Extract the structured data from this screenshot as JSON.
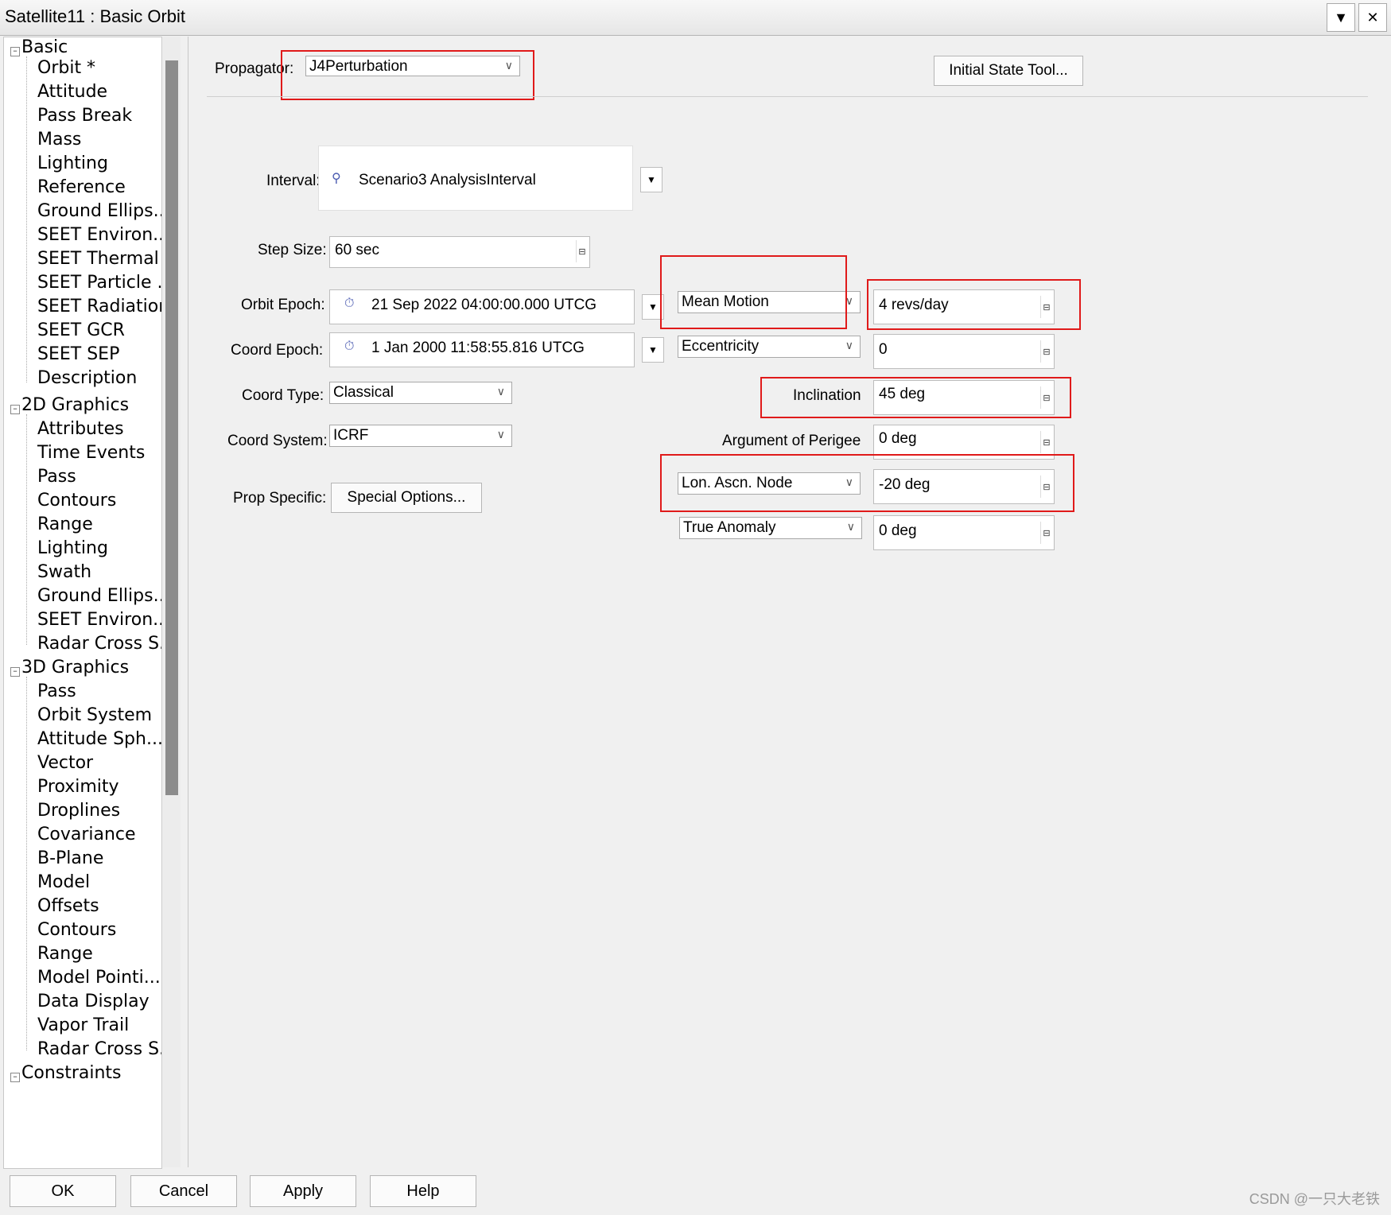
{
  "window": {
    "title": "Satellite11 : Basic Orbit",
    "menu_icon": "chevron-down-icon",
    "close_label": "✕"
  },
  "tree": {
    "groups": [
      {
        "label": "Basic",
        "items": [
          "Orbit *",
          "Attitude",
          "Pass Break",
          "Mass",
          "Lighting",
          "Reference",
          "Ground Ellips...",
          "SEET Environ...",
          "SEET Thermal",
          "SEET Particle ...",
          "SEET Radiation",
          "SEET GCR",
          "SEET SEP",
          "Description"
        ]
      },
      {
        "label": "2D Graphics",
        "items": [
          "Attributes",
          "Time Events",
          "Pass",
          "Contours",
          "Range",
          "Lighting",
          "Swath",
          "Ground Ellips...",
          "SEET Environ...",
          "Radar Cross S..."
        ]
      },
      {
        "label": "3D Graphics",
        "items": [
          "Pass",
          "Orbit System",
          "Attitude Sph...",
          "Vector",
          "Proximity",
          "Droplines",
          "Covariance",
          "B-Plane",
          "Model",
          "Offsets",
          "Contours",
          "Range",
          "Model Pointi...",
          "Data Display",
          "Vapor Trail",
          "Radar Cross S..."
        ]
      },
      {
        "label": "Constraints",
        "items": []
      }
    ]
  },
  "propagator": {
    "label": "Propagator:",
    "value": "J4Perturbation"
  },
  "initial_state_button": "Initial State Tool...",
  "interval": {
    "label": "Interval:",
    "value": "Scenario3 AnalysisInterval"
  },
  "step_size": {
    "label": "Step Size:",
    "value": "60 sec"
  },
  "orbit_epoch": {
    "label": "Orbit Epoch:",
    "value": "21 Sep 2022 04:00:00.000 UTCG"
  },
  "coord_epoch": {
    "label": "Coord Epoch:",
    "value": "1 Jan 2000 11:58:55.816 UTCG"
  },
  "coord_type": {
    "label": "Coord Type:",
    "value": "Classical"
  },
  "coord_system": {
    "label": "Coord System:",
    "value": "ICRF"
  },
  "prop_specific": {
    "label": "Prop Specific:",
    "button": "Special Options..."
  },
  "elements": {
    "size_type": "Mean Motion",
    "size_value": "4 revs/day",
    "shape_type": "Eccentricity",
    "shape_value": "0",
    "inclination_label": "Inclination",
    "inclination_value": "45 deg",
    "arg_perigee_label": "Argument of Perigee",
    "arg_perigee_value": "0 deg",
    "node_type": "Lon. Ascn. Node",
    "node_value": "-20 deg",
    "anomaly_type": "True Anomaly",
    "anomaly_value": "0 deg"
  },
  "footer": {
    "ok": "OK",
    "cancel": "Cancel",
    "apply": "Apply",
    "help": "Help"
  },
  "watermark": "CSDN @一只大老铁",
  "colors": {
    "highlight": "#e01a1a"
  }
}
